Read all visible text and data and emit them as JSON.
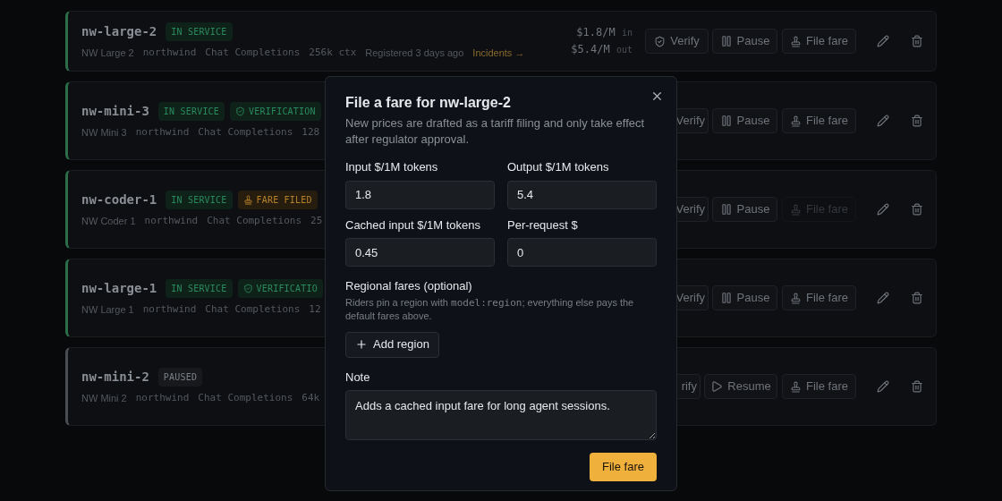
{
  "models": [
    {
      "name": "nw-large-2",
      "paused": false,
      "badges": [
        {
          "kind": "status",
          "label": "IN SERVICE"
        }
      ],
      "meta": [
        {
          "kind": "label",
          "text": "NW Large 2"
        },
        {
          "kind": "code",
          "text": "northwind"
        },
        {
          "kind": "code",
          "text": "Chat Completions"
        },
        {
          "kind": "code",
          "text": "256k ctx"
        },
        {
          "kind": "label",
          "text": "Registered 3 days ago"
        }
      ],
      "link": "Incidents →",
      "prices": [
        {
          "amount": "$1.8/M",
          "unit": "in"
        },
        {
          "amount": "$5.4/M",
          "unit": "out"
        }
      ],
      "verify": {
        "label": "Verify",
        "partly_hidden": false
      },
      "toggle": {
        "kind": "pause",
        "label": "Pause"
      },
      "fare": {
        "label": "File fare",
        "disabled": false
      }
    },
    {
      "name": "nw-mini-3",
      "paused": false,
      "badges": [
        {
          "kind": "status",
          "label": "IN SERVICE"
        },
        {
          "kind": "verification",
          "label": "VERIFICATION"
        }
      ],
      "meta": [
        {
          "kind": "label",
          "text": "NW Mini 3"
        },
        {
          "kind": "code",
          "text": "northwind"
        },
        {
          "kind": "code",
          "text": "Chat Completions"
        },
        {
          "kind": "code",
          "text": "128"
        }
      ],
      "verify": {
        "label": "Verify",
        "partly_hidden": true
      },
      "toggle": {
        "kind": "pause",
        "label": "Pause"
      },
      "fare": {
        "label": "File fare",
        "disabled": false
      }
    },
    {
      "name": "nw-coder-1",
      "paused": false,
      "badges": [
        {
          "kind": "status",
          "label": "IN SERVICE"
        },
        {
          "kind": "fare",
          "label": "FARE FILED"
        }
      ],
      "meta": [
        {
          "kind": "label",
          "text": "NW Coder 1"
        },
        {
          "kind": "code",
          "text": "northwind"
        },
        {
          "kind": "code",
          "text": "Chat Completions"
        },
        {
          "kind": "code",
          "text": "25"
        }
      ],
      "verify": {
        "label": "Verify",
        "partly_hidden": true
      },
      "toggle": {
        "kind": "pause",
        "label": "Pause"
      },
      "fare": {
        "label": "File fare",
        "disabled": true
      }
    },
    {
      "name": "nw-large-1",
      "paused": false,
      "badges": [
        {
          "kind": "status",
          "label": "IN SERVICE"
        },
        {
          "kind": "verification",
          "label": "VERIFICATIO"
        }
      ],
      "meta": [
        {
          "kind": "label",
          "text": "NW Large 1"
        },
        {
          "kind": "code",
          "text": "northwind"
        },
        {
          "kind": "code",
          "text": "Chat Completions"
        },
        {
          "kind": "code",
          "text": "12"
        }
      ],
      "verify": {
        "label": "Verify",
        "partly_hidden": true
      },
      "toggle": {
        "kind": "pause",
        "label": "Pause"
      },
      "fare": {
        "label": "File fare",
        "disabled": false
      }
    },
    {
      "name": "nw-mini-2",
      "paused": true,
      "badges": [
        {
          "kind": "paused",
          "label": "PAUSED"
        }
      ],
      "meta": [
        {
          "kind": "label",
          "text": "NW Mini 2"
        },
        {
          "kind": "code",
          "text": "northwind"
        },
        {
          "kind": "code",
          "text": "Chat Completions"
        },
        {
          "kind": "code",
          "text": "64k"
        }
      ],
      "verify": {
        "label": "rify",
        "partly_hidden": true
      },
      "toggle": {
        "kind": "resume",
        "label": "Resume"
      },
      "fare": {
        "label": "File fare",
        "disabled": false
      }
    }
  ],
  "dialog": {
    "title": "File a fare for nw-large-2",
    "description": "New prices are drafted as a tariff filing and only take effect after regulator approval.",
    "fields": [
      {
        "label": "Input $/1M tokens",
        "value": "1.8"
      },
      {
        "label": "Output $/1M tokens",
        "value": "5.4"
      },
      {
        "label": "Cached input $/1M tokens",
        "value": "0.45"
      },
      {
        "label": "Per-request $",
        "value": "0"
      }
    ],
    "regional": {
      "label": "Regional fares (optional)",
      "hint": [
        {
          "kind": "text",
          "text": "Riders pin a region with "
        },
        {
          "kind": "code",
          "text": "model:region"
        },
        {
          "kind": "text",
          "text": "; everything else pays the default fares above."
        }
      ],
      "add_button": "Add region"
    },
    "note": {
      "label": "Note",
      "value": "Adds a cached input fare for long agent sessions."
    },
    "submit": "File fare"
  }
}
